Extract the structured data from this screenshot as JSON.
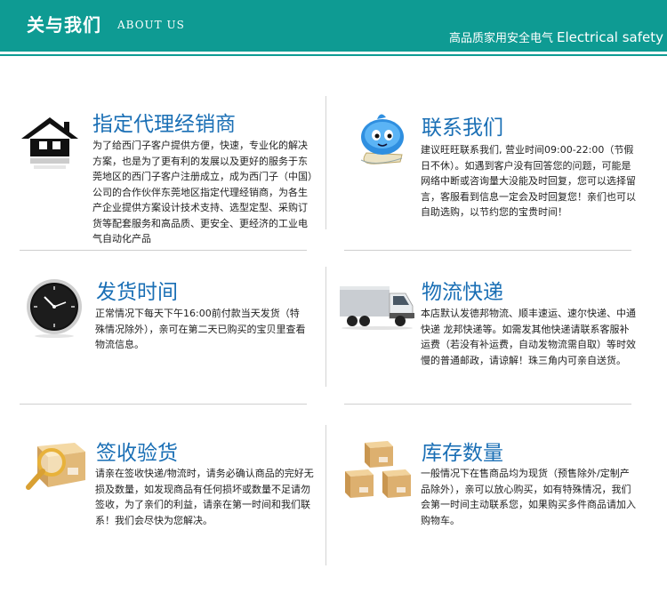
{
  "header": {
    "title": "关与我们",
    "subtitle": "ABOUT US",
    "slogan_cn": "高品质家用安全电气",
    "slogan_en": "Electrical safety"
  },
  "sections": [
    {
      "title": "指定代理经销商",
      "icon": "house-icon",
      "body": "为了给西门子客户提供方便，快速，专业化的解决方案，也是为了更有利的发展以及更好的服务于东莞地区的西门子客户注册成立，成为西门子（中国）公司的合作伙伴东莞地区指定代理经销商，为各生产企业提供方案设计技术支持、选型定型、采购订货等配套服务和高品质、更安全、更经济的工业电气自动化产品"
    },
    {
      "title": "联系我们",
      "icon": "chat-mascot-icon",
      "body": "建议旺旺联系我们, 营业时间09:00-22:00（节假日不休）。如遇到客户没有回答您的问题，可能是网络中断或咨询量大没能及时回复，您可以选择留言，客服看到信息一定会及时回复您！亲们也可以自助选购，以节约您的宝贵时间！"
    },
    {
      "title": "发货时间",
      "icon": "clock-icon",
      "body": "正常情况下每天下午16:00前付款当天发货（特殊情况除外），亲可在第二天已购买的宝贝里查看物流信息。"
    },
    {
      "title": "物流快递",
      "icon": "truck-icon",
      "body": "本店默认发德邦物流、顺丰速运、速尔快递、中通快递 龙邦快递等。如需发其他快递请联系客服补运费（若没有补运费，自动发物流需自取）等时效慢的普通邮政，请谅解！珠三角内可亲自送货。"
    },
    {
      "title": "签收验货",
      "icon": "magnifier-box-icon",
      "body": "请亲在签收快递/物流时，请务必确认商品的完好无损及数量，如发现商品有任何损坏或数量不足请勿签收，为了亲们的利益，请亲在第一时间和我们联系！我们会尽快为您解决。"
    },
    {
      "title": "库存数量",
      "icon": "boxes-icon",
      "body": "一般情况下在售商品均为现货（预售除外/定制产品除外），亲可以放心购买，如有特殊情况，我们会第一时间主动联系您，如果购买多件商品请加入购物车。"
    }
  ]
}
